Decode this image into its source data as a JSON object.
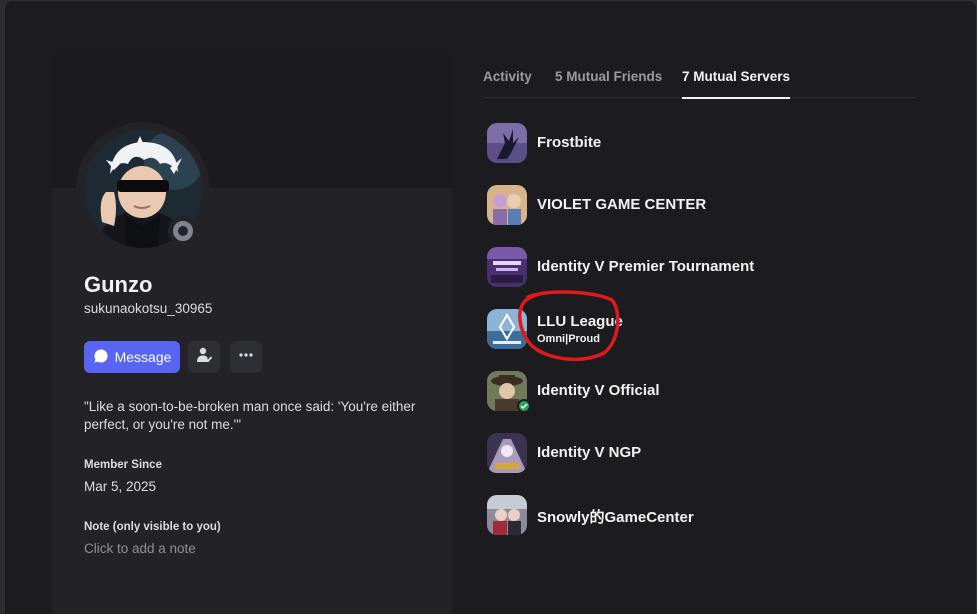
{
  "profile": {
    "display_name": "Gunzo",
    "username": "sukunaokotsu_30965",
    "message_label": "Message",
    "bio": "\"Like a soon-to-be-broken man once said: 'You're either perfect, or you're not me.'\"",
    "member_since_title": "Member Since",
    "member_since_value": "Mar 5, 2025",
    "note_title": "Note (only visible to you)",
    "note_placeholder": "Click to add a note"
  },
  "tabs": [
    {
      "label": "Activity"
    },
    {
      "label": "5 Mutual Friends"
    },
    {
      "label": "7 Mutual Servers"
    }
  ],
  "servers": [
    {
      "name": "Frostbite",
      "nickname": ""
    },
    {
      "name": "VIOLET GAME CENTER",
      "nickname": ""
    },
    {
      "name": "Identity V Premier Tournament",
      "nickname": ""
    },
    {
      "name": "LLU League",
      "nickname": "Omni|Proud"
    },
    {
      "name": "Identity V Official",
      "nickname": ""
    },
    {
      "name": "Identity V NGP",
      "nickname": ""
    },
    {
      "name": "Snowly的GameCenter",
      "nickname": ""
    }
  ],
  "colors": {
    "accent": "#5865f2",
    "background": "#1c1b1f",
    "card": "#232327",
    "annotation": "#e0191b"
  },
  "icons": {
    "message": "chat-bubble-icon",
    "add_friend": "add-friend-icon",
    "more": "more-horizontal-icon"
  }
}
